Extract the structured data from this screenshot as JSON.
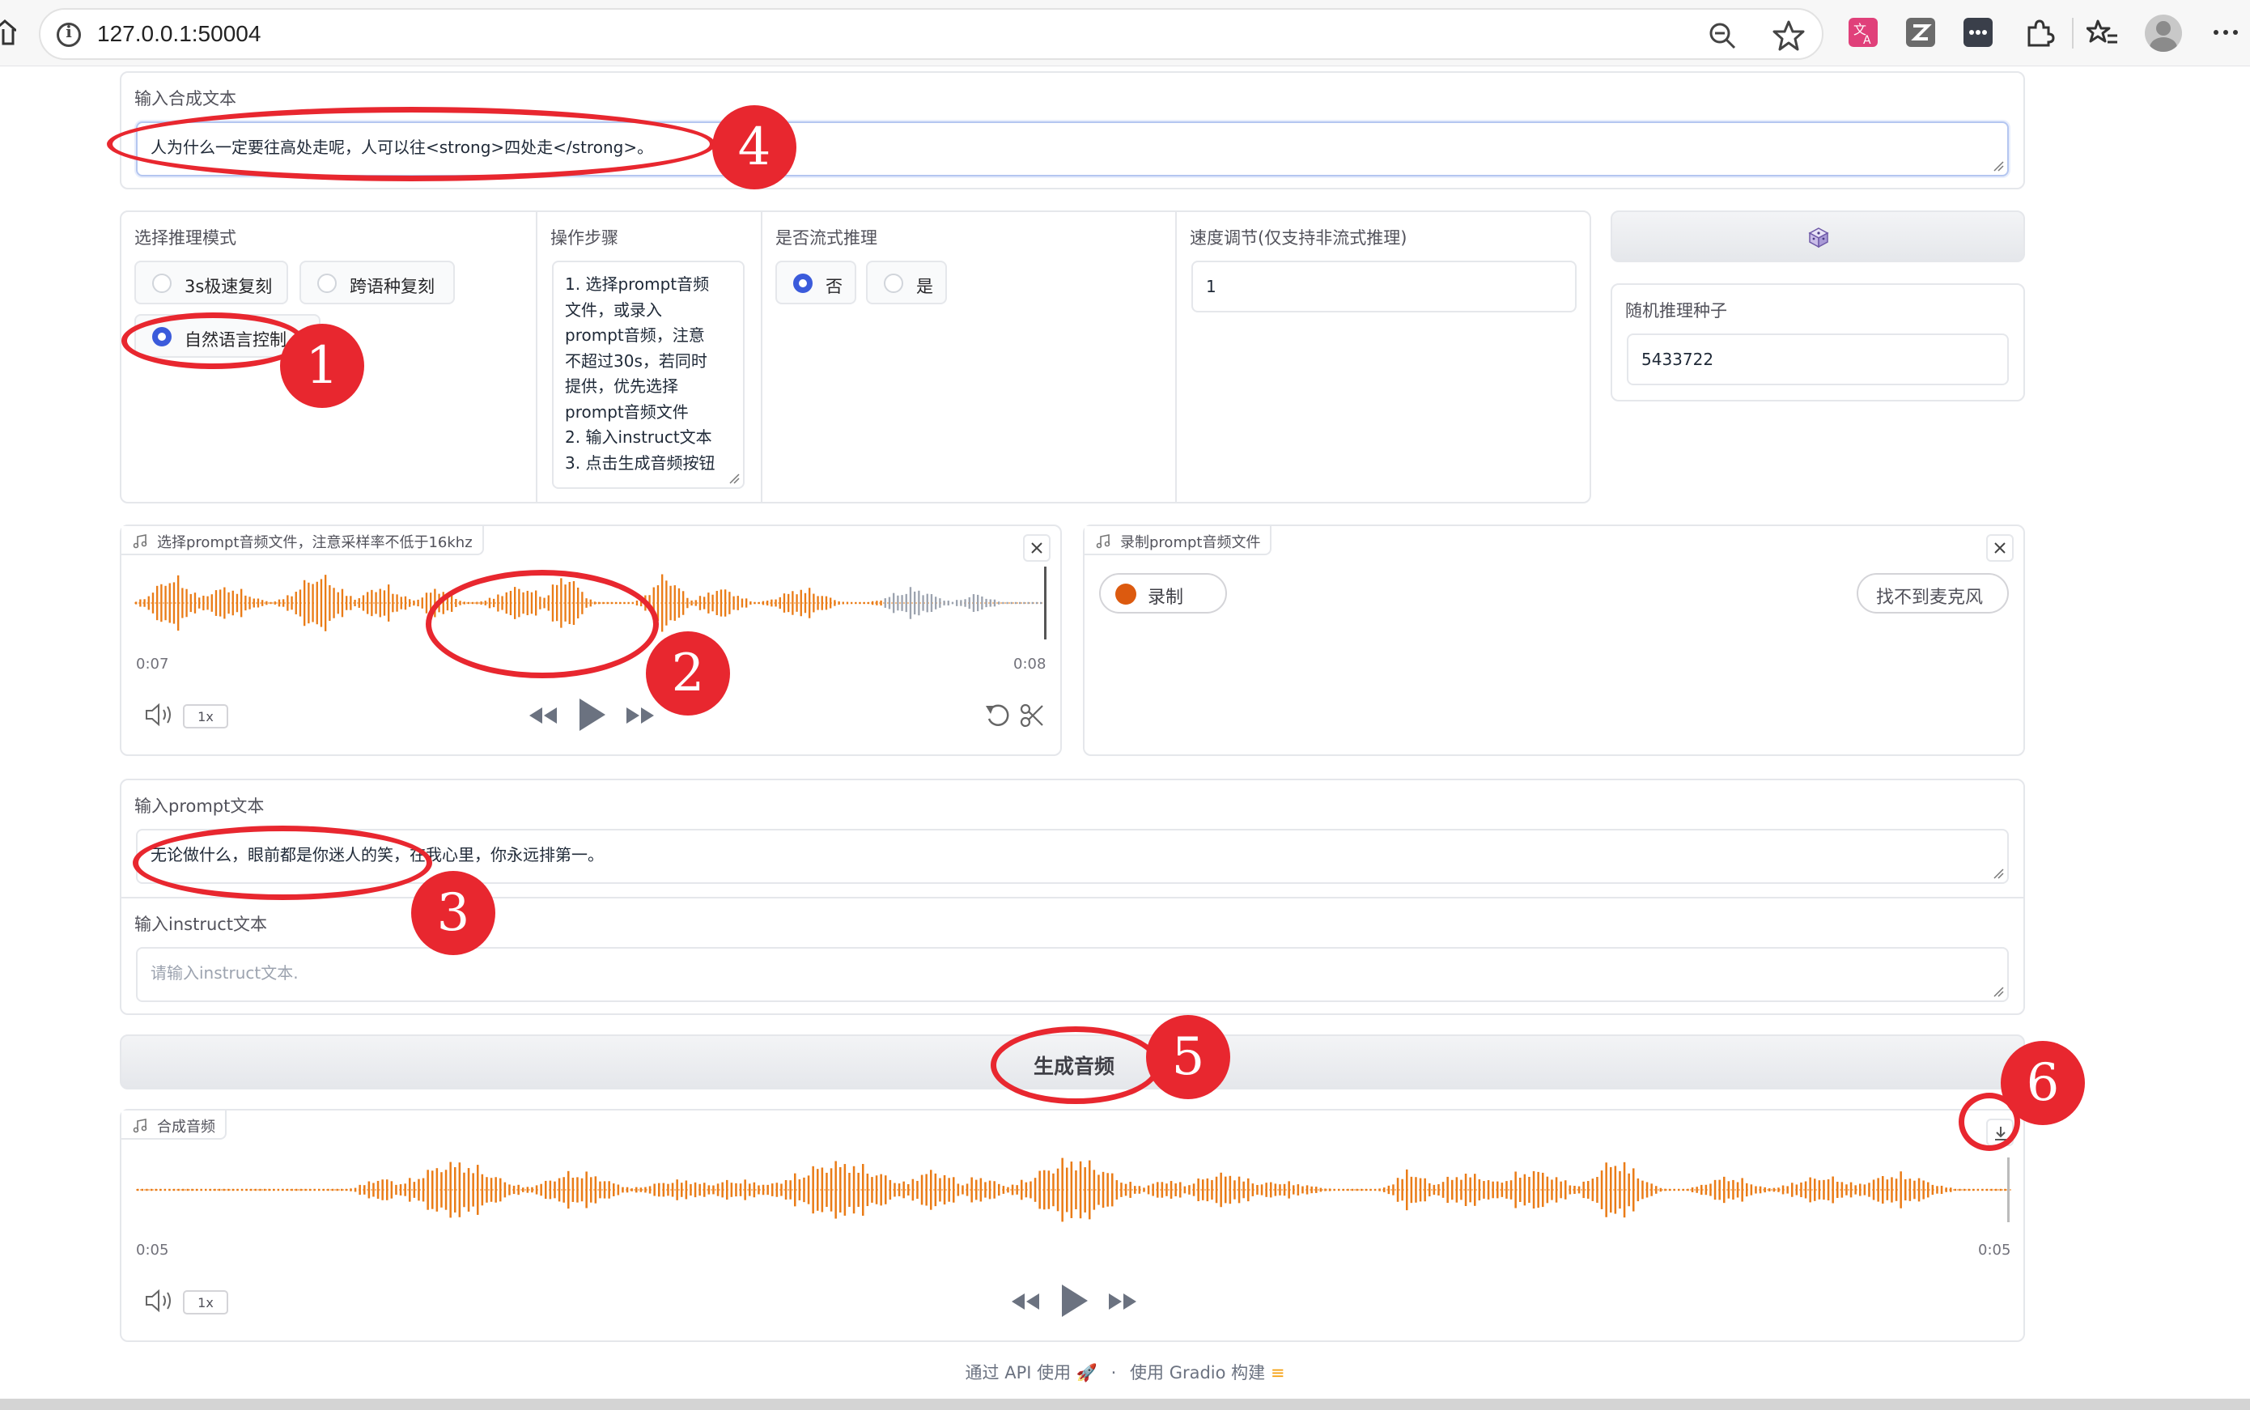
{
  "browser": {
    "url": "127.0.0.1:50004"
  },
  "synth_text": {
    "label": "输入合成文本",
    "value": "人为什么一定要往高处走呢，人可以往<strong>四处走</strong>。"
  },
  "mode": {
    "label": "选择推理模式",
    "options": [
      "3s极速复刻",
      "跨语种复刻",
      "自然语言控制"
    ],
    "selected_index": 2
  },
  "steps": {
    "label": "操作步骤",
    "lines": [
      "1. 选择prompt音频",
      "文件，或录入",
      "prompt音频，注意",
      "不超过30s，若同时",
      "提供，优先选择",
      "prompt音频文件",
      "2. 输入instruct文本",
      "3. 点击生成音频按钮"
    ]
  },
  "stream": {
    "label": "是否流式推理",
    "options": [
      "否",
      "是"
    ],
    "selected_index": 0
  },
  "speed": {
    "label": "速度调节(仅支持非流式推理)",
    "value": "1"
  },
  "dice": {
    "icon": "dice-icon"
  },
  "seed": {
    "label": "随机推理种子",
    "value": "5433722"
  },
  "prompt_audio": {
    "label": "选择prompt音频文件，注意采样率不低于16khz",
    "current": "0:07",
    "duration": "0:08",
    "speed": "1x",
    "progress": 0.82,
    "played_color": "#ea7c17",
    "unplayed_color": "#9ca3af"
  },
  "record_audio": {
    "label": "录制prompt音频文件",
    "record_button": "录制",
    "mic_button": "找不到麦克风",
    "record_dot_color": "#dc5a0f"
  },
  "prompt_text": {
    "label": "输入prompt文本",
    "value": "无论做什么，眼前都是你迷人的笑，在我心里，你永远排第一。"
  },
  "instruct_text": {
    "label": "输入instruct文本",
    "placeholder": "请输入instruct文本."
  },
  "generate": {
    "label": "生成音频"
  },
  "output_audio": {
    "label": "合成音频",
    "current": "0:05",
    "duration": "0:05",
    "speed": "1x"
  },
  "footer": {
    "api": "通过 API 使用",
    "sep": "·",
    "built": "使用 Gradio 构建"
  },
  "annotations": [
    "1",
    "2",
    "3",
    "4",
    "5",
    "6"
  ],
  "colors": {
    "accent": "#3b5bdb",
    "annotation": "#e8272f",
    "wave": "#ea7c17"
  }
}
